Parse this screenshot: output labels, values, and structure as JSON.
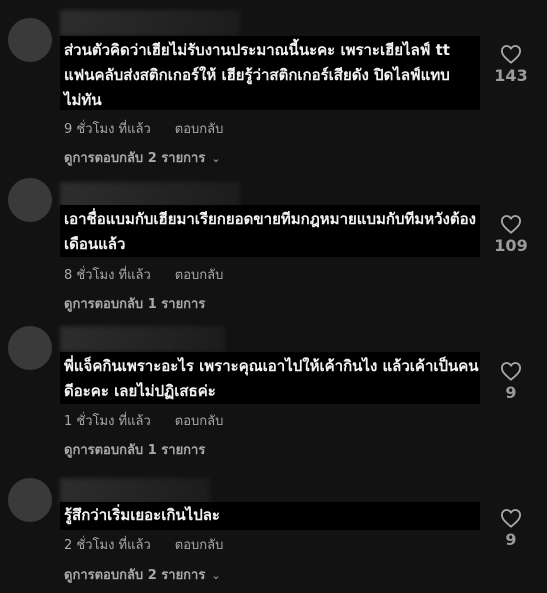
{
  "comments": [
    {
      "text": "ส่วนตัวคิดว่าเฮียไม่รับงานประมาณนี้นะคะ เพราะเฮียไลฟ์ tt แฟนคลับส่งสติกเกอร์ให้ เฮียรู้ว่าสติกเกอร์เสียดัง ปิดไลฟ์แทบไม่ทัน",
      "time": "9 ชั่วโมง ที่แล้ว",
      "reply_label": "ตอบกลับ",
      "view_replies": "ดูการตอบกลับ 2 รายการ",
      "likes": "143"
    },
    {
      "text": "เอาชื่อแบมกับเฮียมาเรียกยอดขายทีมกฎหมายแบมกับทีมหวังต้องเดือนแล้ว",
      "time": "8 ชั่วโมง ที่แล้ว",
      "reply_label": "ตอบกลับ",
      "view_replies": "ดูการตอบกลับ 1 รายการ",
      "likes": "109"
    },
    {
      "text": "พี่แจ็คกินเพราะอะไร เพราะคุณเอาไปให้เค้ากินไง แล้วเค้าเป็นคนดีอะคะ เลยไม่ปฏิเสธค่ะ",
      "time": "1 ชั่วโมง ที่แล้ว",
      "reply_label": "ตอบกลับ",
      "view_replies": "ดูการตอบกลับ 1 รายการ",
      "likes": "9"
    },
    {
      "text": "รู้สึกว่าเริ่มเยอะเกินไปละ",
      "time": "2 ชั่วโมง ที่แล้ว",
      "reply_label": "ตอบกลับ",
      "view_replies": "ดูการตอบกลับ 2 รายการ",
      "likes": "9"
    }
  ],
  "icons": {
    "like": "heart-outline-icon",
    "expand": "chevron-down-icon"
  },
  "colors": {
    "background": "#121212",
    "muted": "#a8a8a8"
  }
}
